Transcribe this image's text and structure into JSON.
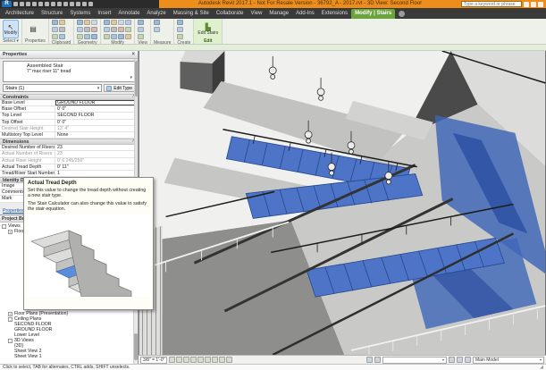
{
  "colors": {
    "accent_orange": "#ED8E1C",
    "accent_green": "#6DA33C",
    "selection_blue": "#3D66B8",
    "ribbon_bg": "#EEF1EA"
  },
  "title_bar": {
    "app_title": "Autodesk Revit 2017.1 - Not For Resale Version  -  36792_A - 2017.rvt - 3D View: Second Floor",
    "search_placeholder": "Type a keyword or phrase",
    "right_icons": [
      "exchange-apps-icon",
      "sign-in-icon",
      "help-icon"
    ]
  },
  "qat": {
    "icons": [
      "open-file-icon",
      "save-icon",
      "sync-icon",
      "undo-icon",
      "redo-icon",
      "print-icon",
      "measure-icon",
      "aligned-dimension-icon",
      "tag-icon",
      "text-icon",
      "default-3d-view-icon",
      "section-icon",
      "thin-lines-icon"
    ]
  },
  "ribbon": {
    "tabs": [
      {
        "label": "Architecture"
      },
      {
        "label": "Structure"
      },
      {
        "label": "Systems"
      },
      {
        "label": "Insert"
      },
      {
        "label": "Annotate"
      },
      {
        "label": "Analyze"
      },
      {
        "label": "Massing & Site"
      },
      {
        "label": "Collaborate"
      },
      {
        "label": "View"
      },
      {
        "label": "Manage"
      },
      {
        "label": "Add-Ins"
      },
      {
        "label": "Extensions"
      },
      {
        "label": "Modify | Stairs",
        "active": true
      }
    ],
    "groups": [
      {
        "label": "Select ▾",
        "type": "big",
        "buttons": [
          {
            "name": "modify-button",
            "label": "Modify",
            "icon": "cursor-icon",
            "highlighted": true
          }
        ]
      },
      {
        "label": "Properties",
        "type": "big",
        "buttons": [
          {
            "name": "properties-button",
            "label": "",
            "icon": "properties-palette-icon"
          }
        ]
      },
      {
        "label": "Clipboard",
        "type": "grid",
        "icons": [
          "paste-icon",
          "cut-to-clipboard-icon",
          "copy-to-clipboard-icon",
          "match-type-icon",
          "delete-icon",
          "pin-icon"
        ]
      },
      {
        "label": "Geometry",
        "type": "grid",
        "icons": [
          "cope-icon",
          "cut-geometry-icon",
          "join-icon",
          "wall-joins-icon",
          "split-face-icon",
          "paint-icon",
          "demolish-icon",
          "beam-joins-icon",
          "unjoin-icon"
        ]
      },
      {
        "label": "Modify",
        "type": "grid",
        "icons": [
          "align-icon",
          "offset-icon",
          "mirror-icon",
          "move-icon",
          "copy-icon",
          "rotate-icon",
          "trim-icon",
          "split-icon",
          "array-icon",
          "scale-icon",
          "pin-modify-icon",
          "delete-modify-icon"
        ]
      },
      {
        "label": "View",
        "type": "grid",
        "icons": [
          "selection-box-icon",
          "hide-element-icon",
          "override-graphics-icon"
        ]
      },
      {
        "label": "Measure",
        "type": "grid",
        "icons": [
          "measure-tool-icon",
          "aligned-dim-icon"
        ]
      },
      {
        "label": "Create",
        "type": "grid",
        "icons": [
          "create-group-icon",
          "create-similar-icon",
          "create-assembly-icon"
        ]
      },
      {
        "label": "Edit",
        "type": "big",
        "accent": true,
        "buttons": [
          {
            "name": "edit-stairs-button",
            "label": "Edit Stairs",
            "icon": "edit-stairs-icon"
          }
        ]
      }
    ]
  },
  "properties": {
    "header": "Properties",
    "type_name": "Assembled Stair",
    "type_desc": "7\" max riser 11\" tread",
    "selector": "Stairs (1)",
    "edit_type_label": "Edit Type",
    "help_link": "Properties help",
    "sections": [
      {
        "name": "Constraints",
        "rows": [
          {
            "label": "Base Level",
            "value": "GROUND FLOOR",
            "state": "selected"
          },
          {
            "label": "Base Offset",
            "value": "0' 0\""
          },
          {
            "label": "Top Level",
            "value": "SECOND FLOOR"
          },
          {
            "label": "Top Offset",
            "value": "0' 0\""
          },
          {
            "label": "Desired Stair Height",
            "value": "13' 4\"",
            "state": "disabled"
          },
          {
            "label": "Multistory Top Level",
            "value": "None"
          }
        ]
      },
      {
        "name": "Dimensions",
        "rows": [
          {
            "label": "Desired Number of Risers",
            "value": "23"
          },
          {
            "label": "Actual Number of Risers",
            "value": "23",
            "state": "disabled"
          },
          {
            "label": "Actual Riser Height",
            "value": "0' 6 245/256\"",
            "state": "disabled"
          },
          {
            "label": "Actual Tread Depth",
            "value": "0' 11\""
          },
          {
            "label": "Tread/Riser Start Number",
            "value": "1"
          }
        ]
      },
      {
        "name": "Identity Data",
        "rows": [
          {
            "label": "Image",
            "value": ""
          },
          {
            "label": "Comments",
            "value": ""
          },
          {
            "label": "Mark",
            "value": ""
          }
        ]
      }
    ]
  },
  "tooltip": {
    "title": "Actual Tread Depth",
    "body1": "Set this value to change the tread depth without creating a new stair type.",
    "body2": "The Stair Calculator can also change this value to satisfy the stair equation."
  },
  "project_browser": {
    "header": "Project Browser - 36792_A - 2017.rvt",
    "items": [
      {
        "label": "Views",
        "level": 0,
        "expander": "minus"
      },
      {
        "label": "Floor Plans",
        "level": 1,
        "expander": "plus",
        "gap_after": true
      },
      {
        "label": "Floor Plans (Presentation)",
        "level": 1,
        "expander": "plus"
      },
      {
        "label": "Ceiling Plans",
        "level": 1,
        "expander": "minus"
      },
      {
        "label": "SECOND FLOOR",
        "level": 2
      },
      {
        "label": "GROUND FLOOR",
        "level": 2
      },
      {
        "label": "Lower Level",
        "level": 2
      },
      {
        "label": "3D Views",
        "level": 1,
        "expander": "minus"
      },
      {
        "label": "{3D}",
        "level": 2
      },
      {
        "label": "Sheet View 2",
        "level": 2
      },
      {
        "label": "Sheet View 1",
        "level": 2
      }
    ]
  },
  "view_control_bar": {
    "scale": "3/8\" = 1'-0\"",
    "icons": [
      "detail-level-icon",
      "visual-style-icon",
      "sun-path-icon",
      "shadows-icon",
      "rendering-icon",
      "crop-view-icon",
      "crop-region-icon",
      "temporary-hide-icon",
      "reveal-hidden-icon"
    ]
  },
  "status_bar": {
    "message": "Click to select, TAB for alternates, CTRL adds, SHIFT unselects.",
    "workset_value": "",
    "design_option": "Main Model",
    "left_icons": [
      "worksets-icon",
      "editable-only-icon"
    ],
    "right_icons": [
      "exclude-options-icon",
      "filter-funnel-icon",
      "select-count-icon"
    ]
  }
}
